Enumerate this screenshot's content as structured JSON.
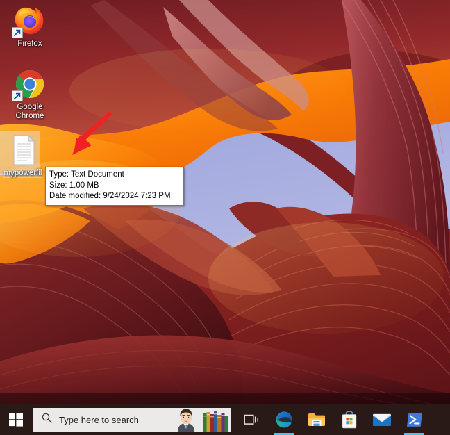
{
  "desktop": {
    "wallpaper_name": "antelope-canyon-wallpaper",
    "icons": [
      {
        "id": "firefox",
        "label": "Firefox",
        "icon": "firefox-icon",
        "shortcut": true,
        "selected": false
      },
      {
        "id": "chrome",
        "label": "Google Chrome",
        "icon": "google-chrome-icon",
        "shortcut": true,
        "selected": false
      },
      {
        "id": "textfile",
        "label": "mypowerfil",
        "icon": "text-document-icon",
        "shortcut": false,
        "selected": true
      }
    ]
  },
  "tooltip": {
    "type_line": "Type: Text Document",
    "size_line": "Size: 1.00 MB",
    "date_line": "Date modified: 9/24/2024 7:23 PM"
  },
  "annotation": {
    "arrow_color": "#ee2222",
    "arrow_name": "red-pointer-arrow"
  },
  "taskbar": {
    "start_label": "Start",
    "start_icon": "windows-logo-icon",
    "search": {
      "placeholder": "Type here to search",
      "icon": "search-icon",
      "art": "person-with-books-illustration"
    },
    "task_view_label": "Task View",
    "buttons": [
      {
        "id": "taskview",
        "label": "Task View",
        "icon": "task-view-icon",
        "active": false
      },
      {
        "id": "edge",
        "label": "Microsoft Edge",
        "icon": "microsoft-edge-icon",
        "active": true
      },
      {
        "id": "explorer",
        "label": "File Explorer",
        "icon": "file-explorer-icon",
        "active": false
      },
      {
        "id": "store",
        "label": "Microsoft Store",
        "icon": "microsoft-store-icon",
        "active": false
      },
      {
        "id": "mail",
        "label": "Mail",
        "icon": "mail-icon",
        "active": false
      },
      {
        "id": "powershell",
        "label": "Windows PowerShell",
        "icon": "powershell-icon",
        "active": true
      }
    ]
  },
  "colors": {
    "taskbar_bg": "#2a1a17",
    "search_bg": "#eceae8",
    "accent": "#4cc2f1",
    "tooltip_bg": "#ffffff",
    "tooltip_border": "#767676",
    "sky": "#a9aedd",
    "rock_orange": "#f4770a",
    "rock_red": "#8f1f23"
  }
}
